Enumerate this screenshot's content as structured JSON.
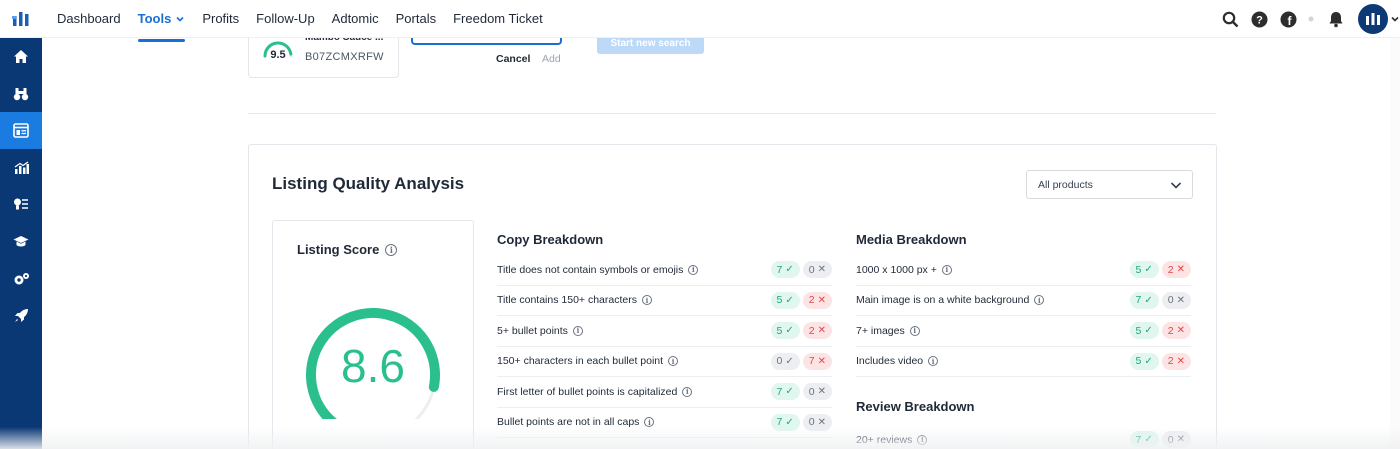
{
  "nav": {
    "links": [
      "Dashboard",
      "Tools",
      "Profits",
      "Follow-Up",
      "Adtomic",
      "Portals",
      "Freedom Ticket"
    ],
    "active": "Tools"
  },
  "product_card": {
    "name": "Mambo Sauce ...",
    "asin": "B07ZCMXRFW",
    "score": "9.5"
  },
  "search": {
    "cancel_label": "Cancel",
    "add_label": "Add",
    "new_search_label": "Start new search"
  },
  "panel": {
    "title": "Listing Quality Analysis",
    "filter": "All products"
  },
  "listing_score": {
    "title": "Listing Score",
    "value": "8.6",
    "fraction": 0.86
  },
  "copy": {
    "title": "Copy Breakdown",
    "rows": [
      {
        "label": "Title does not contain symbols or emojis",
        "pass": "7",
        "fail": "0"
      },
      {
        "label": "Title contains 150+ characters",
        "pass": "5",
        "fail": "2"
      },
      {
        "label": "5+ bullet points",
        "pass": "5",
        "fail": "2"
      },
      {
        "label": "150+ characters in each bullet point",
        "pass": "0",
        "fail": "7"
      },
      {
        "label": "First letter of bullet points is capitalized",
        "pass": "7",
        "fail": "0"
      },
      {
        "label": "Bullet points are not in all caps",
        "pass": "7",
        "fail": "0"
      }
    ]
  },
  "media": {
    "title": "Media Breakdown",
    "rows": [
      {
        "label": "1000 x 1000 px +",
        "pass": "5",
        "fail": "2"
      },
      {
        "label": "Main image is on a white background",
        "pass": "7",
        "fail": "0"
      },
      {
        "label": "7+ images",
        "pass": "5",
        "fail": "2"
      },
      {
        "label": "Includes video",
        "pass": "5",
        "fail": "2"
      }
    ]
  },
  "review": {
    "title": "Review Breakdown",
    "rows": [
      {
        "label": "20+ reviews",
        "pass": "7",
        "fail": "0"
      }
    ]
  },
  "colors": {
    "accent": "#1a6fd3",
    "sidebar": "#0a3875",
    "pass": "#1ea87a",
    "fail": "#e04848",
    "gauge": "#2bbf8e"
  }
}
